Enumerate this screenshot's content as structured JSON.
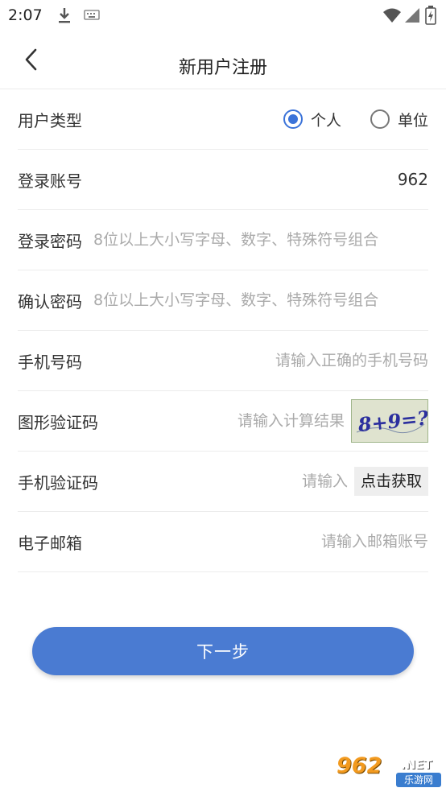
{
  "status_bar": {
    "time": "2:07",
    "icons": [
      "download-icon",
      "keyboard-icon",
      "wifi-icon",
      "signal-icon",
      "battery-icon"
    ]
  },
  "nav": {
    "title": "新用户注册",
    "back_icon": "chevron-left-icon"
  },
  "form": {
    "user_type": {
      "label": "用户类型",
      "options": [
        {
          "label": "个人",
          "checked": true
        },
        {
          "label": "单位",
          "checked": false
        }
      ]
    },
    "account": {
      "label": "登录账号",
      "value": "962"
    },
    "password": {
      "label": "登录密码",
      "placeholder": "8位以上大小写字母、数字、特殊符号组合"
    },
    "confirm_password": {
      "label": "确认密码",
      "placeholder": "8位以上大小写字母、数字、特殊符号组合"
    },
    "phone": {
      "label": "手机号码",
      "placeholder": "请输入正确的手机号码"
    },
    "captcha": {
      "label": "图形验证码",
      "placeholder": "请输入计算结果",
      "image_text": "8+9=?"
    },
    "sms_code": {
      "label": "手机验证码",
      "placeholder": "请输入",
      "button_label": "点击获取"
    },
    "email": {
      "label": "电子邮箱",
      "placeholder": "请输入邮箱账号"
    }
  },
  "next_button": {
    "label": "下一步"
  },
  "watermark": {
    "brand": "962",
    "suffix": ".NET",
    "subtitle": "乐游网"
  },
  "colors": {
    "accent": "#3b73d9",
    "button": "#4a7bd2",
    "placeholder": "#aaaaaa",
    "divider": "#ececec"
  }
}
